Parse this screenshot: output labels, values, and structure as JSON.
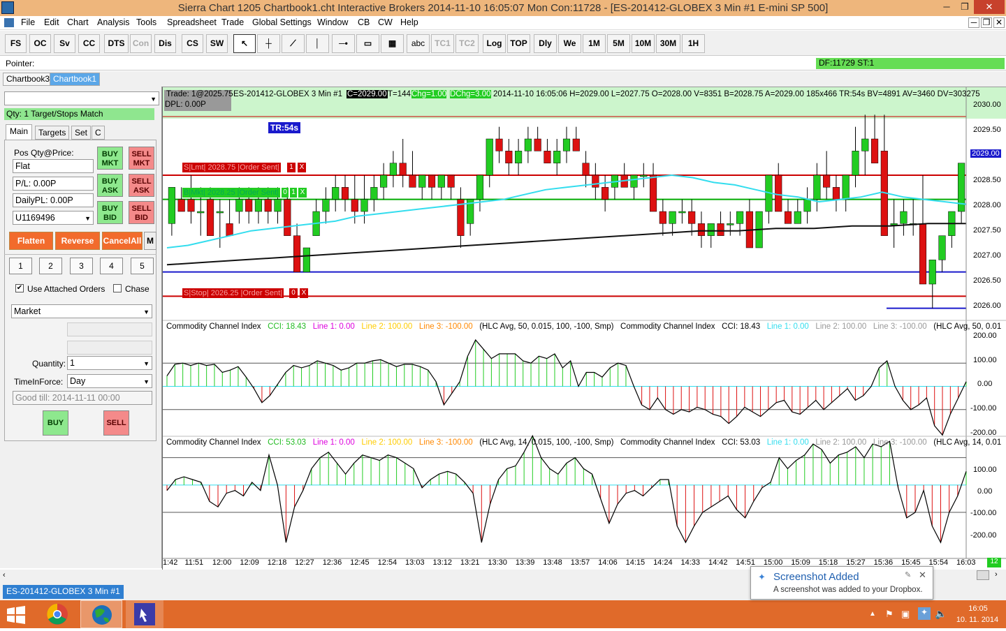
{
  "window": {
    "title": "Sierra Chart 1205 Chartbook1.cht  Interactive Brokers 2014-11-10  16:05:07 Mon  Con:11728  - [ES-201412-GLOBEX  3 Min  #1  E-mini SP 500]"
  },
  "menu": [
    "File",
    "Edit",
    "Chart",
    "Analysis",
    "Tools",
    "Spreadsheet",
    "Trade",
    "Global Settings",
    "Window",
    "CB",
    "CW",
    "Help"
  ],
  "toolbar": {
    "buttons": [
      "FS",
      "OC",
      "Sv",
      "CC",
      "DTS",
      "Con",
      "Dis",
      "CS",
      "SW"
    ],
    "tools": [
      "abc",
      "TC1",
      "TC2",
      "Log",
      "TOP",
      "Dly",
      "We",
      "1M",
      "5M",
      "10M",
      "30M",
      "1H"
    ]
  },
  "pointer": {
    "label": "Pointer:",
    "df": "DF:11729  ST:1"
  },
  "tabs": [
    "Chartbook3",
    "Chartbook1"
  ],
  "trade_panel": {
    "dropdown": "",
    "status": "Qty: 1 Target/Stops Match",
    "tabs": [
      "Main",
      "Targets",
      "Set",
      "C"
    ],
    "pos_label": "Pos Qty@Price:",
    "pos_value": "Flat",
    "pl": "P/L: 0.00P",
    "daily_pl": "DailyPL: 0.00P",
    "account": "U1169496",
    "buy_mkt": "BUY MKT",
    "sell_mkt": "SELL MKT",
    "buy_ask": "BUY ASK",
    "sell_ask": "SELL ASK",
    "buy_bid": "BUY BID",
    "sell_bid": "SELL BID",
    "flatten": "Flatten",
    "reverse": "Reverse",
    "cancel_all": "CancelAll",
    "m": "M",
    "nums": [
      "1",
      "2",
      "3",
      "4",
      "5"
    ],
    "use_attached": "Use Attached Orders",
    "chase": "Chase",
    "order_type": "Market",
    "quantity_label": "Quantity:",
    "quantity": "1",
    "tif_label": "TimeInForce:",
    "tif": "Day",
    "good_till": "Good till: 2014-11-11 00:00",
    "buy": "BUY",
    "sell": "SELL"
  },
  "chart_header": {
    "trade": "Trade: 1@2025.75",
    "dpl": "DPL: 0.00P",
    "symbol": "ES-201412-GLOBEX  3 Min  #1",
    "close": "C=2029.00",
    "t": "T=144",
    "chg": "Chg=1.00",
    "dchg": "DChg=3.00",
    "rest": "2014-11-10 16:05:06 H=2029.00 L=2027.75 O=2028.00 V=8351 B=2028.75 A=2029.00 185x466 TR:54s BV=4891 AV=3460 DV=303275",
    "tr": "TR:54s"
  },
  "orders": [
    {
      "label": "S|Lmt| 2028.75 |Order Sent|",
      "qty": "1",
      "x": "X",
      "price": 2028.75,
      "color": "#cc0000"
    },
    {
      "label": "B|Mkt| 2028.25 |Order Sent|",
      "qty": "0",
      "extra": "1",
      "x": "X",
      "price": 2028.25,
      "color": "#00aa00"
    },
    {
      "label": "S|Stop| 2026.25 |Order Sent|",
      "qty": "0",
      "x": "X",
      "price": 2026.25,
      "color": "#cc0000"
    }
  ],
  "price_axis": {
    "labels": [
      "2030.00",
      "2029.50",
      "2029.00",
      "2028.50",
      "2028.00",
      "2027.50",
      "2027.00",
      "2026.50",
      "2026.00"
    ],
    "current": "2029.00"
  },
  "cci1": {
    "name": "Commodity Channel Index",
    "cci": "CCI: 18.43",
    "l1": "Line 1: 0.00",
    "l2": "Line 2: 100.00",
    "l3": "Line 3: -100.00",
    "params": "(HLC Avg, 50, 0.015, 100, -100, Smp)",
    "name2": "Commodity Channel Index",
    "cci2": "CCI: 18.43",
    "l1b": "Line 1: 0.00",
    "l2b": "Line 2: 100.00",
    "l3b": "Line 3: -100.00",
    "params2": "(HLC Avg, 50, 0.01",
    "axis": [
      "200.00",
      "100.00",
      "0.00",
      "-100.00",
      "-200.00"
    ]
  },
  "cci2": {
    "name": "Commodity Channel Index",
    "cci": "CCI: 53.03",
    "l1": "Line 1: 0.00",
    "l2": "Line 2: 100.00",
    "l3": "Line 3: -100.00",
    "params": "(HLC Avg, 14, 0.015, 100, -100, Smp)",
    "name2": "Commodity Channel Index",
    "cci2": "CCI: 53.03",
    "l1b": "Line 1: 0.00",
    "l2b": "Line 2: 100.00",
    "l3b": "Line 3: -100.00",
    "params2": "(HLC Avg, 14, 0.01",
    "axis": [
      "100.00",
      "0.00",
      "-100.00",
      "-200.00"
    ]
  },
  "time_axis": [
    "1:42",
    "11:51",
    "12:00",
    "12:09",
    "12:18",
    "12:27",
    "12:36",
    "12:45",
    "12:54",
    "13:03",
    "13:12",
    "13:21",
    "13:30",
    "13:39",
    "13:48",
    "13:57",
    "14:06",
    "14:15",
    "14:24",
    "14:33",
    "14:42",
    "14:51",
    "15:00",
    "15:09",
    "15:18",
    "15:27",
    "15:36",
    "15:45",
    "15:54",
    "16:03"
  ],
  "bottom": {
    "tab": "ES-201412-GLOBEX  3 Min  #1",
    "badge": "12"
  },
  "toast": {
    "title": "Screenshot Added",
    "body": "A screenshot was added to your Dropbox."
  },
  "taskbar": {
    "time": "16:05",
    "date": "10. 11. 2014"
  },
  "colors": {
    "title_bar": "#eeb67c",
    "up": "#22cc22",
    "down": "#dd1111",
    "ma_fast": "#33ddee",
    "ma_slow": "#111111",
    "taskbar": "#e06a2a"
  },
  "chart_data": [
    {
      "type": "candlestick",
      "title": "ES-201412-GLOBEX 3 Min",
      "ylim": [
        2025.75,
        2030.25
      ],
      "bars": [
        [
          2027.75,
          2028.5,
          2027.5,
          2028.5
        ],
        [
          2028.25,
          2028.5,
          2028.0,
          2028.0
        ],
        [
          2028.25,
          2028.75,
          2027.75,
          2028.0
        ],
        [
          2028.0,
          2028.5,
          2027.5,
          2028.0
        ],
        [
          2028.25,
          2028.5,
          2027.5,
          2027.5
        ],
        [
          2028.0,
          2028.25,
          2027.25,
          2028.0
        ],
        [
          2027.75,
          2028.25,
          2027.5,
          2027.5
        ],
        [
          2028.0,
          2028.5,
          2027.75,
          2028.25
        ],
        [
          2028.25,
          2028.5,
          2027.75,
          2028.0
        ],
        [
          2028.0,
          2028.5,
          2027.75,
          2028.25
        ],
        [
          2028.25,
          2028.5,
          2027.75,
          2028.0
        ],
        [
          2028.0,
          2028.5,
          2027.75,
          2028.25
        ],
        [
          2028.25,
          2028.5,
          2027.5,
          2027.5
        ],
        [
          2027.5,
          2027.75,
          2026.75,
          2026.75
        ],
        [
          2026.75,
          2027.25,
          2026.75,
          2027.25
        ],
        [
          2027.5,
          2028.25,
          2027.5,
          2028.0
        ],
        [
          2028.0,
          2028.5,
          2027.75,
          2028.25
        ],
        [
          2028.25,
          2028.75,
          2028.0,
          2028.5
        ],
        [
          2028.5,
          2028.75,
          2028.0,
          2028.25
        ],
        [
          2028.25,
          2028.75,
          2027.75,
          2028.0
        ],
        [
          2028.0,
          2028.75,
          2027.75,
          2028.25
        ],
        [
          2028.25,
          2028.75,
          2028.0,
          2028.5
        ],
        [
          2028.5,
          2029.0,
          2028.25,
          2028.75
        ],
        [
          2028.75,
          2029.25,
          2028.5,
          2029.0
        ],
        [
          2029.0,
          2029.5,
          2028.5,
          2028.75
        ],
        [
          2028.75,
          2029.25,
          2028.5,
          2028.5
        ],
        [
          2028.5,
          2028.75,
          2028.25,
          2028.75
        ],
        [
          2028.75,
          2028.75,
          2028.25,
          2028.5
        ],
        [
          2028.5,
          2028.75,
          2028.25,
          2028.75
        ],
        [
          2028.75,
          2028.75,
          2028.25,
          2028.5
        ],
        [
          2028.25,
          2028.5,
          2027.25,
          2027.5
        ],
        [
          2027.75,
          2028.25,
          2027.5,
          2028.25
        ],
        [
          2028.25,
          2028.75,
          2028.0,
          2028.75
        ],
        [
          2028.75,
          2029.5,
          2028.5,
          2029.5
        ],
        [
          2029.5,
          2029.75,
          2029.0,
          2029.25
        ],
        [
          2029.25,
          2029.5,
          2028.75,
          2029.0
        ],
        [
          2029.0,
          2029.5,
          2028.75,
          2029.25
        ],
        [
          2029.25,
          2029.75,
          2029.0,
          2029.5
        ],
        [
          2029.5,
          2029.75,
          2029.25,
          2029.25
        ],
        [
          2029.25,
          2029.5,
          2029.0,
          2029.0
        ],
        [
          2029.0,
          2029.5,
          2028.75,
          2029.25
        ],
        [
          2029.25,
          2029.75,
          2029.0,
          2029.5
        ],
        [
          2029.5,
          2029.75,
          2029.25,
          2029.25
        ],
        [
          2029.0,
          2029.25,
          2028.5,
          2028.75
        ],
        [
          2028.75,
          2029.0,
          2028.25,
          2028.5
        ],
        [
          2028.5,
          2028.75,
          2028.0,
          2028.25
        ],
        [
          2028.5,
          2028.75,
          2028.25,
          2028.75
        ],
        [
          2028.75,
          2029.0,
          2028.5,
          2028.5
        ],
        [
          2028.5,
          2028.75,
          2028.25,
          2028.75
        ],
        [
          2028.75,
          2029.0,
          2028.5,
          2028.75
        ],
        [
          2028.75,
          2029.0,
          2028.0,
          2028.0
        ],
        [
          2028.0,
          2028.25,
          2027.5,
          2027.75
        ],
        [
          2027.75,
          2028.0,
          2027.5,
          2028.0
        ],
        [
          2028.0,
          2028.25,
          2027.75,
          2028.0
        ],
        [
          2028.0,
          2028.25,
          2027.5,
          2027.75
        ],
        [
          2027.75,
          2028.0,
          2027.25,
          2027.5
        ],
        [
          2027.5,
          2027.75,
          2027.25,
          2027.75
        ],
        [
          2027.75,
          2028.0,
          2027.5,
          2027.5
        ],
        [
          2027.75,
          2028.0,
          2027.5,
          2027.75
        ],
        [
          2027.75,
          2028.0,
          2027.5,
          2028.0
        ],
        [
          2028.0,
          2028.25,
          2027.25,
          2027.25
        ],
        [
          2027.25,
          2028.0,
          2027.25,
          2028.0
        ],
        [
          2028.0,
          2028.75,
          2027.75,
          2028.75
        ],
        [
          2028.75,
          2029.0,
          2028.0,
          2028.0
        ],
        [
          2028.0,
          2028.25,
          2027.75,
          2027.75
        ],
        [
          2027.75,
          2028.25,
          2027.75,
          2028.0
        ],
        [
          2028.0,
          2028.5,
          2027.75,
          2028.25
        ],
        [
          2028.25,
          2029.0,
          2028.0,
          2028.75
        ],
        [
          2028.75,
          2029.25,
          2028.25,
          2028.5
        ],
        [
          2028.5,
          2028.75,
          2028.0,
          2028.25
        ],
        [
          2028.25,
          2028.75,
          2028.0,
          2028.75
        ],
        [
          2028.75,
          2029.75,
          2028.5,
          2029.25
        ],
        [
          2029.25,
          2030.0,
          2028.75,
          2029.5
        ],
        [
          2029.5,
          2030.0,
          2029.0,
          2029.0
        ],
        [
          2029.25,
          2030.0,
          2027.5,
          2027.5
        ],
        [
          2027.75,
          2028.25,
          2027.25,
          2027.75
        ],
        [
          2027.75,
          2028.25,
          2027.5,
          2028.0
        ],
        [
          2027.75,
          2028.25,
          2027.5,
          2027.75
        ],
        [
          2027.75,
          2028.75,
          2026.5,
          2026.5
        ],
        [
          2026.5,
          2027.0,
          2026.0,
          2027.0
        ],
        [
          2027.0,
          2027.5,
          2026.75,
          2027.5
        ],
        [
          2027.5,
          2028.0,
          2027.25,
          2028.0
        ],
        [
          2028.0,
          2029.0,
          2027.75,
          2029.0
        ]
      ],
      "ma_fast": [
        2027.25,
        2027.3,
        2027.4,
        2027.5,
        2027.6,
        2027.65,
        2027.7,
        2027.75,
        2027.8,
        2027.9,
        2027.95,
        2028.0,
        2028.05,
        2028.1,
        2028.15,
        2028.2,
        2028.25,
        2028.35,
        2028.45,
        2028.5,
        2028.55,
        2028.6,
        2028.65,
        2028.7,
        2028.75,
        2028.7,
        2028.6,
        2028.55,
        2028.45,
        2028.35,
        2028.3,
        2028.2,
        2028.25,
        2028.3,
        2028.4,
        2028.3,
        2028.25,
        2028.2,
        2028.15
      ],
      "ma_slow": [
        2026.9,
        2026.95,
        2027.0,
        2027.05,
        2027.1,
        2027.15,
        2027.2,
        2027.25,
        2027.3,
        2027.35,
        2027.4,
        2027.45,
        2027.5,
        2027.55,
        2027.6,
        2027.6,
        2027.65,
        2027.65,
        2027.7,
        2027.7,
        2027.75,
        2027.75
      ]
    },
    {
      "type": "bar",
      "title": "Commodity Channel Index (50)",
      "ylim": [
        -230,
        230
      ],
      "values": [
        45,
        95,
        100,
        90,
        100,
        90,
        95,
        60,
        70,
        85,
        40,
        -10,
        -70,
        -40,
        10,
        60,
        90,
        80,
        90,
        110,
        100,
        90,
        70,
        80,
        100,
        100,
        110,
        115,
        100,
        85,
        95,
        95,
        85,
        70,
        20,
        -80,
        -30,
        20,
        130,
        200,
        160,
        120,
        140,
        140,
        140,
        110,
        100,
        130,
        120,
        140,
        80,
        110,
        0,
        60,
        60,
        40,
        80,
        100,
        90,
        0,
        -80,
        -100,
        -50,
        -100,
        -120,
        -100,
        -110,
        -90,
        -100,
        -120,
        -130,
        -160,
        -130,
        -90,
        -110,
        -130,
        -100,
        -70,
        -60,
        -110,
        -120,
        -90,
        -60,
        -100,
        -70,
        -40,
        -10,
        -60,
        -40,
        0,
        80,
        110,
        0,
        -60,
        -100,
        -80,
        -50,
        -170,
        -210,
        -120,
        -50,
        20
      ]
    },
    {
      "type": "bar",
      "title": "Commodity Channel Index (14)",
      "ylim": [
        -230,
        140
      ],
      "values": [
        -20,
        20,
        30,
        20,
        10,
        -60,
        -80,
        -30,
        -20,
        -40,
        10,
        -20,
        110,
        0,
        -210,
        -80,
        -20,
        60,
        100,
        120,
        80,
        40,
        80,
        110,
        100,
        90,
        110,
        100,
        80,
        60,
        -10,
        20,
        40,
        50,
        40,
        10,
        -30,
        -210,
        -70,
        20,
        60,
        70,
        120,
        180,
        100,
        60,
        40,
        80,
        100,
        60,
        40,
        -50,
        -140,
        -70,
        -30,
        -20,
        -40,
        -10,
        20,
        20,
        -150,
        -210,
        -150,
        -100,
        -80,
        -60,
        -40,
        -90,
        -120,
        -60,
        -10,
        10,
        100,
        60,
        90,
        110,
        150,
        130,
        80,
        110,
        120,
        140,
        100,
        150,
        140,
        160,
        -10,
        -120,
        -100,
        -20,
        -150,
        -210,
        -100,
        -40,
        50
      ]
    }
  ]
}
